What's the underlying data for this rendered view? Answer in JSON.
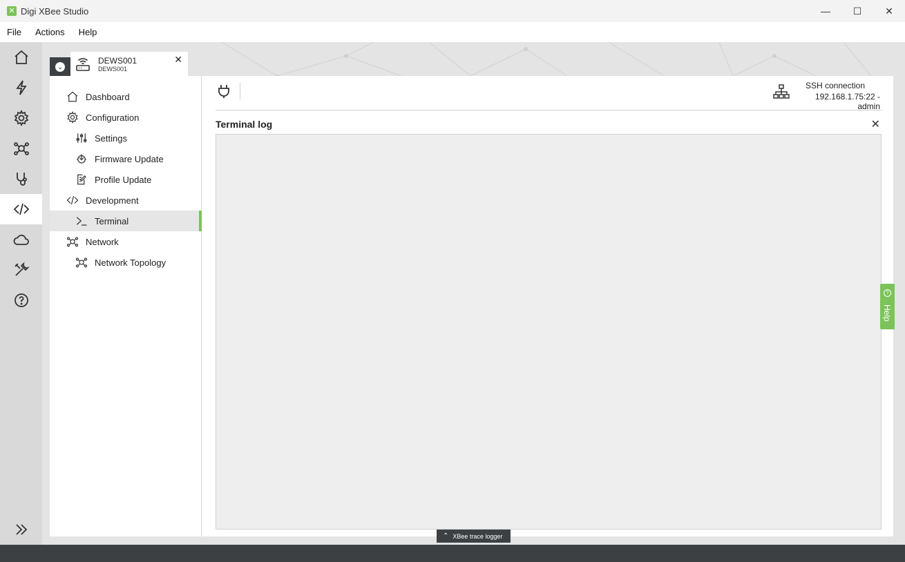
{
  "window": {
    "title": "Digi XBee Studio",
    "minimize": "—",
    "maximize": "☐",
    "close": "✕"
  },
  "menu": {
    "items": [
      "File",
      "Actions",
      "Help"
    ]
  },
  "rail": {
    "items": [
      {
        "icon": "home-icon"
      },
      {
        "icon": "lightning-icon"
      },
      {
        "icon": "gear-icon"
      },
      {
        "icon": "network-icon"
      },
      {
        "icon": "stethoscope-icon"
      },
      {
        "icon": "code-icon",
        "active": true
      },
      {
        "icon": "cloud-icon"
      },
      {
        "icon": "tools-icon"
      },
      {
        "icon": "help-icon"
      }
    ],
    "expand": "»"
  },
  "device_tab": {
    "name": "DEWS001",
    "subtitle": "DEWS001",
    "close": "✕"
  },
  "sidebar": {
    "items": [
      {
        "label": "Dashboard",
        "icon": "home-icon"
      },
      {
        "label": "Configuration",
        "icon": "gear-icon"
      },
      {
        "label": "Settings",
        "icon": "sliders-icon"
      },
      {
        "label": "Firmware Update",
        "icon": "firmware-icon"
      },
      {
        "label": "Profile Update",
        "icon": "profile-edit-icon"
      },
      {
        "label": "Development",
        "icon": "code-icon"
      },
      {
        "label": "Terminal",
        "icon": "terminal-icon",
        "active": true
      },
      {
        "label": "Network",
        "icon": "network-icon"
      },
      {
        "label": "Network Topology",
        "icon": "network-icon"
      }
    ]
  },
  "connection": {
    "title": "SSH connection",
    "address": "192.168.1.75:22 - admin"
  },
  "terminal": {
    "title": "Terminal log",
    "close": "✕"
  },
  "help_tab": {
    "label": "Help",
    "glyph": "?"
  },
  "trace_logger": {
    "label": "XBee trace logger",
    "chevron": "⌃"
  },
  "colors": {
    "accent": "#7cc35a",
    "dark": "#3c4043",
    "rail": "#d9d9d9"
  }
}
